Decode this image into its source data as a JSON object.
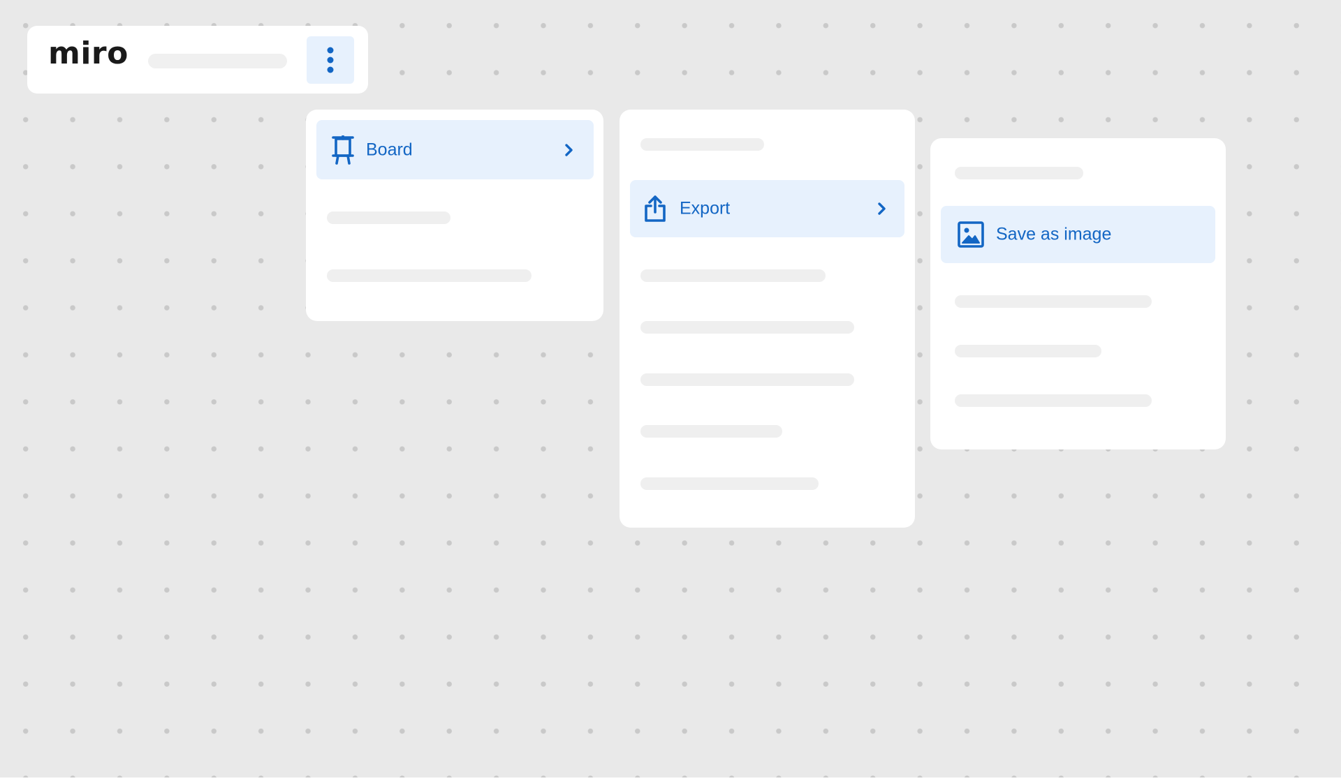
{
  "toolbar": {
    "logo": "miro",
    "more_icon": "vertical-ellipsis-icon"
  },
  "colors": {
    "canvas": "#e9e9e9",
    "accent": "#1366c4",
    "highlight": "#e7f1fd",
    "panel": "#ffffff",
    "placeholder": "#efefef"
  },
  "menus": {
    "board_menu": {
      "item_label": "Board",
      "item_icon": "easel-board-icon",
      "chevron_icon": "chevron-right-icon"
    },
    "board_submenu": {
      "item_label": "Export",
      "item_icon": "share-export-icon",
      "chevron_icon": "chevron-right-icon"
    },
    "export_submenu": {
      "item_label": "Save as image",
      "item_icon": "image-icon"
    }
  }
}
